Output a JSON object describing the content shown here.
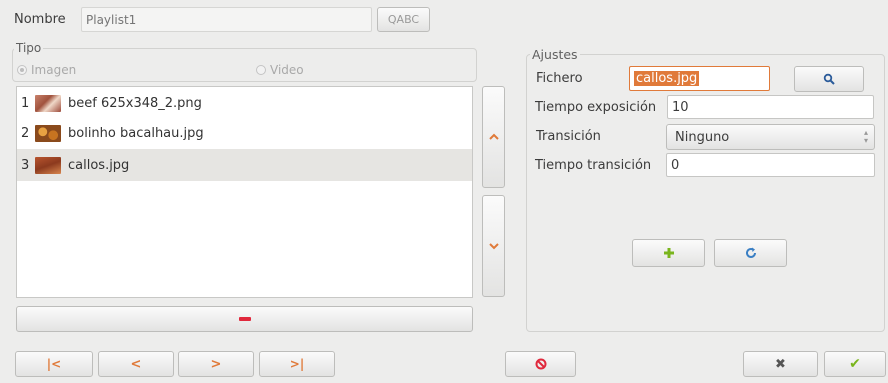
{
  "top": {
    "nombre_label": "Nombre",
    "nombre_placeholder": "Playlist1",
    "abc_button": "ABC"
  },
  "tipo": {
    "legend": "Tipo",
    "imagen": "Imagen",
    "video": "Video"
  },
  "list": {
    "items": [
      {
        "index": "1",
        "name": "beef 625x348_2.png"
      },
      {
        "index": "2",
        "name": "bolinho bacalhau.jpg"
      },
      {
        "index": "3",
        "name": "callos.jpg"
      }
    ]
  },
  "ajustes": {
    "legend": "Ajustes",
    "fichero_label": "Fichero",
    "fichero_value": "callos.jpg",
    "tiempo_exposicion_label": "Tiempo exposición",
    "tiempo_exposicion_value": "10",
    "transicion_label": "Transición",
    "transicion_value": "Ninguno",
    "tiempo_transicion_label": "Tiempo transición",
    "tiempo_transicion_value": "0"
  },
  "colors": {
    "accent_orange": "#e07a3a",
    "accent_red": "#e0283c",
    "accent_green": "#7ab51d",
    "accent_blue": "#3a7fc4"
  }
}
